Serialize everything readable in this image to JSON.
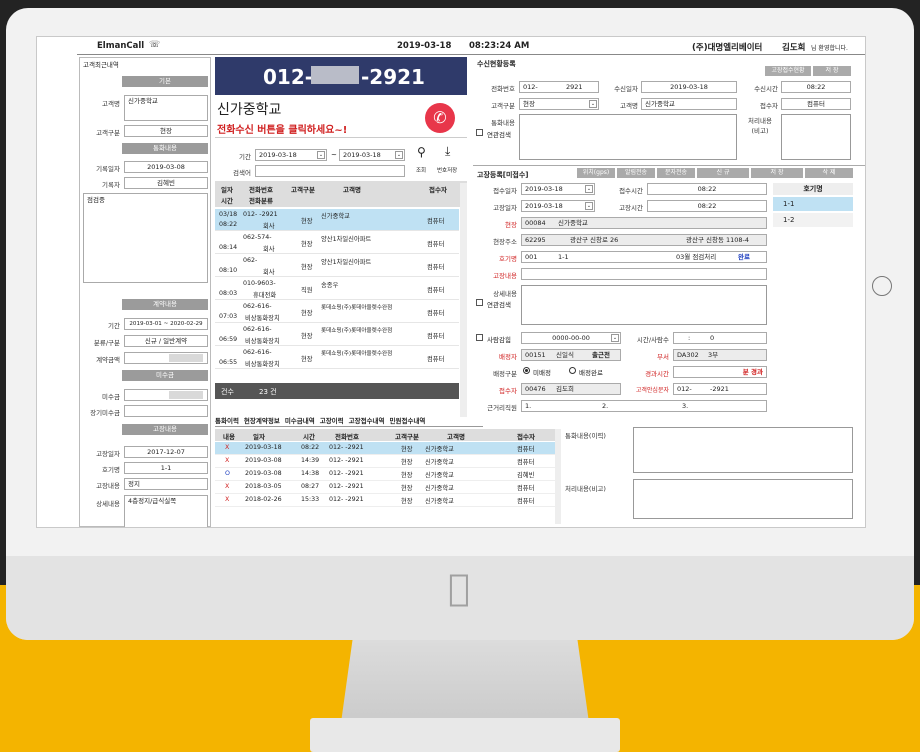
{
  "app": {
    "title": "ElmanCall",
    "date": "2019-03-18",
    "time": "08:23:24 AM",
    "company": "(주)대명엘리베이터",
    "user": "김도희",
    "user_suffix": "님 환영합니다."
  },
  "left": {
    "heading": "고객최근내역",
    "sec_basic": "기본",
    "customer_name_label": "고객명",
    "customer_name": "신가중학교",
    "customer_type_label": "고객구분",
    "customer_type": "현장",
    "sec_call": "통화내용",
    "record_date_label": "기록일자",
    "record_date": "2019-03-08",
    "recorder_label": "기록자",
    "recorder": "김혜빈",
    "memo": "점검중",
    "sec_contract": "계약내용",
    "period_label": "기간",
    "period": "2019-03-01 ~ 2020-02-29",
    "class_label": "분류/구분",
    "class_value": "신규 / 일반계약",
    "contract_amt_label": "계약금액",
    "sec_unpaid": "미수금",
    "unpaid_label": "미수금",
    "long_unpaid_label": "장기미수금",
    "sec_fault": "고장내용",
    "fault_date_label": "고장일자",
    "fault_date": "2017-12-07",
    "unit_label": "호기명",
    "unit": "1-1",
    "fault_content_label": "고장내용",
    "fault_content": "정지",
    "detail_label": "상세내용",
    "detail": "4층정지/급식실쪽"
  },
  "mid": {
    "phone_a": "012-",
    "phone_b": "-2921",
    "customer": "신가중학교",
    "call_hint": "전화수신 버튼을 클릭하세요~!",
    "period_label": "기간",
    "date_from": "2019-03-18",
    "tilde": "~",
    "date_to": "2019-03-18",
    "search_label": "검색어",
    "search_btn": "조회",
    "save_btn": "번호저장",
    "cols": {
      "date": "일자",
      "time": "시간",
      "phone": "전화번호",
      "cat": "전화분류",
      "type": "고객구분",
      "name": "고객명",
      "receiver": "접수자"
    },
    "rows": [
      {
        "date": "03/18",
        "time": "08:22",
        "phone": "012-    -2921",
        "cat": "회사",
        "type": "현장",
        "name": "신가중학교",
        "recv": "컴퓨터"
      },
      {
        "date": "",
        "time": "08:14",
        "phone": "062-574-",
        "cat": "회사",
        "type": "현장",
        "name": "양산1차일신아파트",
        "recv": "컴퓨터"
      },
      {
        "date": "",
        "time": "08:10",
        "phone": "062-",
        "cat": "회사",
        "type": "현장",
        "name": "양산1차일신아파트",
        "recv": "컴퓨터"
      },
      {
        "date": "",
        "time": "08:03",
        "phone": "010-9603-",
        "cat": "휴대전화",
        "type": "직원",
        "name": "송종우",
        "recv": "컴퓨터"
      },
      {
        "date": "",
        "time": "07:03",
        "phone": "062-616-",
        "cat": "비상통화장치",
        "type": "현장",
        "name": "롯데쇼핑(주)롯데아울렛수완점",
        "recv": "컴퓨터"
      },
      {
        "date": "",
        "time": "06:59",
        "phone": "062-616-",
        "cat": "비상통화장치",
        "type": "현장",
        "name": "롯데쇼핑(주)롯데아울렛수완점",
        "recv": "컴퓨터"
      },
      {
        "date": "",
        "time": "06:55",
        "phone": "062-616-",
        "cat": "비상통화장치",
        "type": "현장",
        "name": "롯데쇼핑(주)롯데아울렛수완점",
        "recv": "컴퓨터"
      }
    ],
    "count_label": "건수",
    "count": "23 건"
  },
  "tabs": [
    "통화이력",
    "현장계약정보",
    "미수금내역",
    "고장이력",
    "고장접수내역",
    "민원접수내역"
  ],
  "history": {
    "cols": {
      "content": "내용",
      "date": "일자",
      "time": "시간",
      "phone": "전화번호",
      "type": "고객구분",
      "name": "고객명",
      "recv": "접수자"
    },
    "rows": [
      {
        "mark": "X",
        "date": "2019-03-18",
        "time": "08:22",
        "phone": "012-    -2921",
        "type": "현장",
        "name": "신가중학교",
        "recv": "컴퓨터"
      },
      {
        "mark": "X",
        "date": "2019-03-08",
        "time": "14:39",
        "phone": "012-    -2921",
        "type": "현장",
        "name": "신가중학교",
        "recv": "컴퓨터"
      },
      {
        "mark": "O",
        "date": "2019-03-08",
        "time": "14:38",
        "phone": "012-    -2921",
        "type": "현장",
        "name": "신가중학교",
        "recv": "김혜빈"
      },
      {
        "mark": "X",
        "date": "2018-03-05",
        "time": "08:27",
        "phone": "012-    -2921",
        "type": "현장",
        "name": "신가중학교",
        "recv": "컴퓨터"
      },
      {
        "mark": "X",
        "date": "2018-02-26",
        "time": "15:33",
        "phone": "012-    -2921",
        "type": "현장",
        "name": "신가중학교",
        "recv": "컴퓨터"
      }
    ],
    "call_content_label": "통화내용(이력)",
    "process_label": "처리내용(비고)"
  },
  "recv": {
    "title": "수신현황등록",
    "btn_fault_status": "고장접수현황",
    "btn_save": "저 장",
    "phone_label": "전화번호",
    "phone_a": "012-",
    "phone_b": "2921",
    "recv_date_label": "수신일자",
    "recv_date": "2019-03-18",
    "recv_time_label": "수신시간",
    "recv_time": "08:22",
    "cust_type_label": "고객구분",
    "cust_type": "현장",
    "cust_name_label": "고객명",
    "cust_name": "신가중학교",
    "receiver_label": "접수자",
    "receiver": "컴퓨터",
    "content_label": "통화내용",
    "linked_label": "연관검색",
    "process_label": "처리내용\n(비고)"
  },
  "fault": {
    "title": "고장등록[미접수]",
    "b1": "위치(gps)",
    "b2": "알림전송",
    "b3": "문자전송",
    "b4": "신 규",
    "b5": "저 장",
    "b6": "삭 제",
    "recv_date_label": "접수일자",
    "recv_date": "2019-03-18",
    "recv_time_label": "접수시간",
    "recv_time": "08:22",
    "fault_date_label": "고장일자",
    "fault_date": "2019-03-18",
    "fault_time_label": "고장시간",
    "fault_time": "08:22",
    "site_label": "현장",
    "site_code": "00084",
    "site_name": "신가중학교",
    "addr_label": "현장주소",
    "zip": "62295",
    "addr1": "광산구 신창로 26",
    "addr2": "광산구 신창동 1108-4",
    "unit_label": "호기명",
    "unit_code": "001",
    "unit_name": "1-1",
    "unit_note": "03월 점검처리",
    "done": "완료",
    "fault_content_label": "고장내용",
    "detail_label": "상세내용",
    "linked_label": "연관검색",
    "injury_label": "사람감힘",
    "injury_date": "0000-00-00",
    "people_label": "시간/사람수",
    "colon": ":",
    "people_n": "0",
    "dispatcher_label": "배정자",
    "disp_code": "00151",
    "disp_name": "신일식",
    "disp_status": "출근전",
    "dept_label": "부서",
    "dept_code": "DA302",
    "dept_name": "3부",
    "assign_label": "배정구분",
    "opt1": "미배정",
    "opt2": "배정완료",
    "elapsed_label": "경과시간",
    "elapsed": "분 경과",
    "recv_by_label": "접수자",
    "recv_code": "00476",
    "recv_name": "김도희",
    "safety_label": "고객안심문자",
    "safety_a": "012-",
    "safety_b": "-2921",
    "near_label": "근거리직원",
    "n1": "1.",
    "n2": "2.",
    "n3": "3.",
    "unit_list_head": "호기명",
    "unit_list": [
      "1-1",
      "1-2"
    ]
  }
}
